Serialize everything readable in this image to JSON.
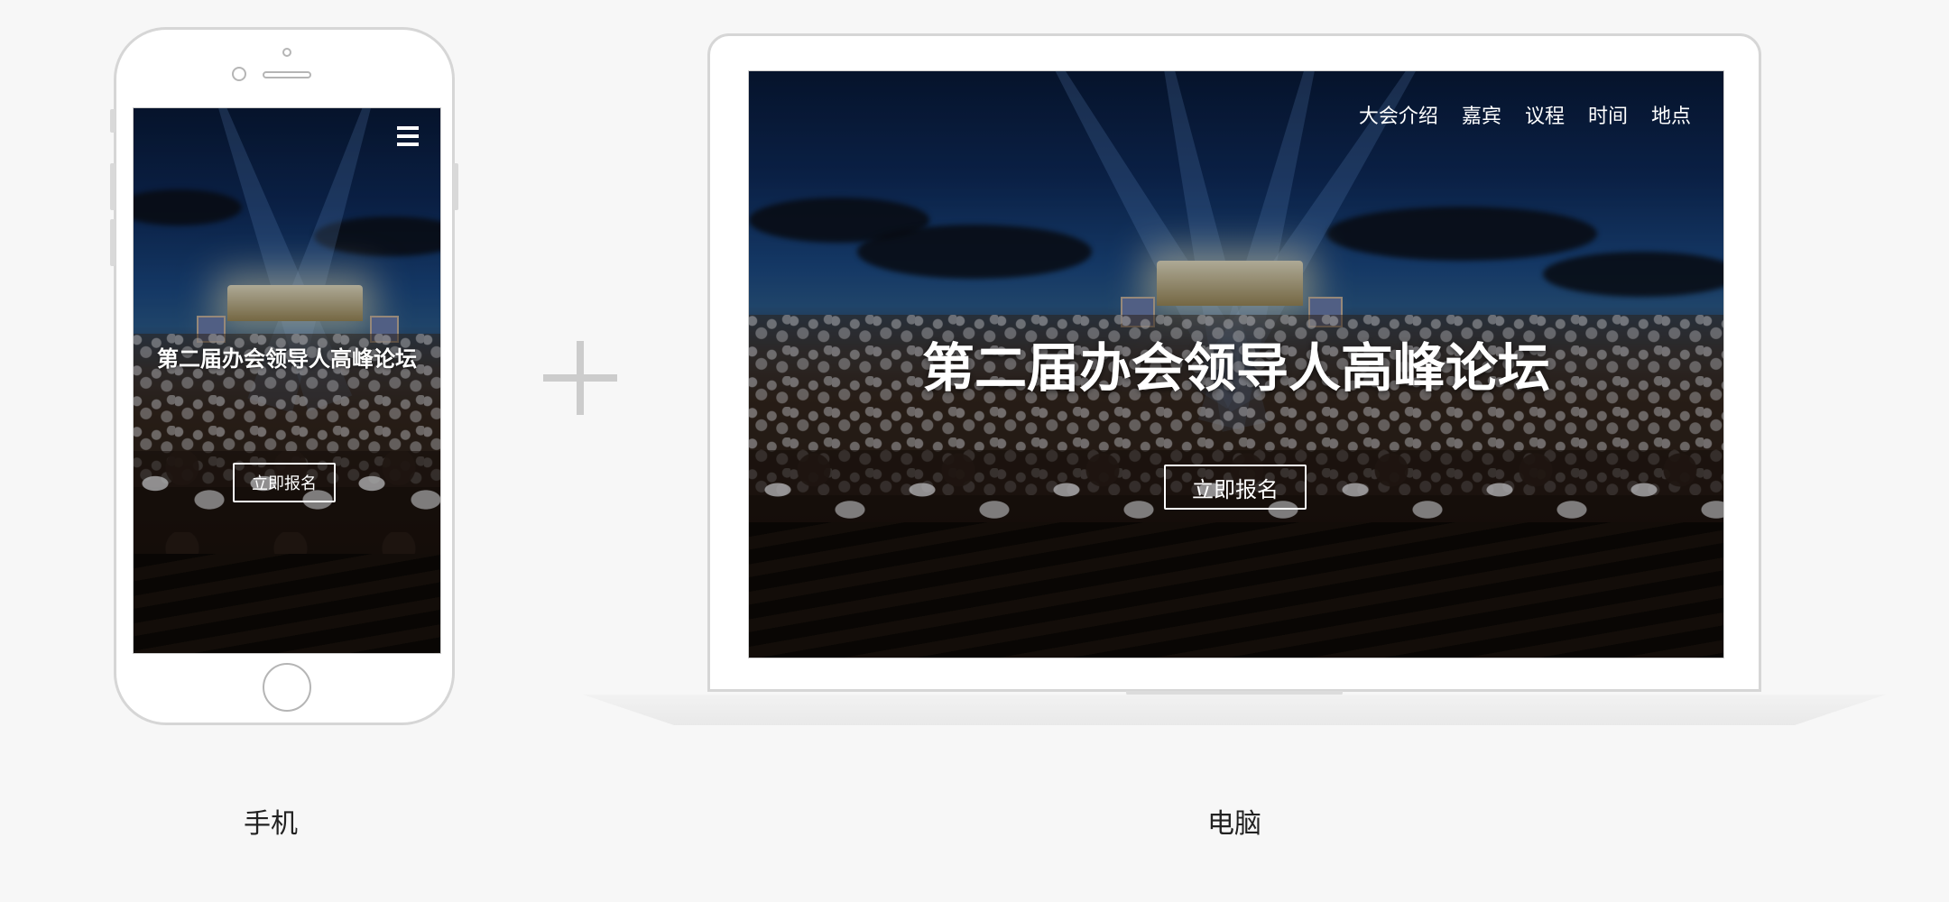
{
  "event_title": "第二届办会领导人高峰论坛",
  "register_label": "立即报名",
  "mobile": {
    "caption": "手机",
    "menu_icon": "hamburger-menu-icon"
  },
  "desktop": {
    "caption": "电脑",
    "nav": [
      "大会介绍",
      "嘉宾",
      "议程",
      "时间",
      "地点"
    ]
  },
  "colors": {
    "background": "#f7f7f7",
    "device_frame": "#d6d6d6",
    "text_on_photo": "#ffffff",
    "caption_text": "#222222"
  }
}
